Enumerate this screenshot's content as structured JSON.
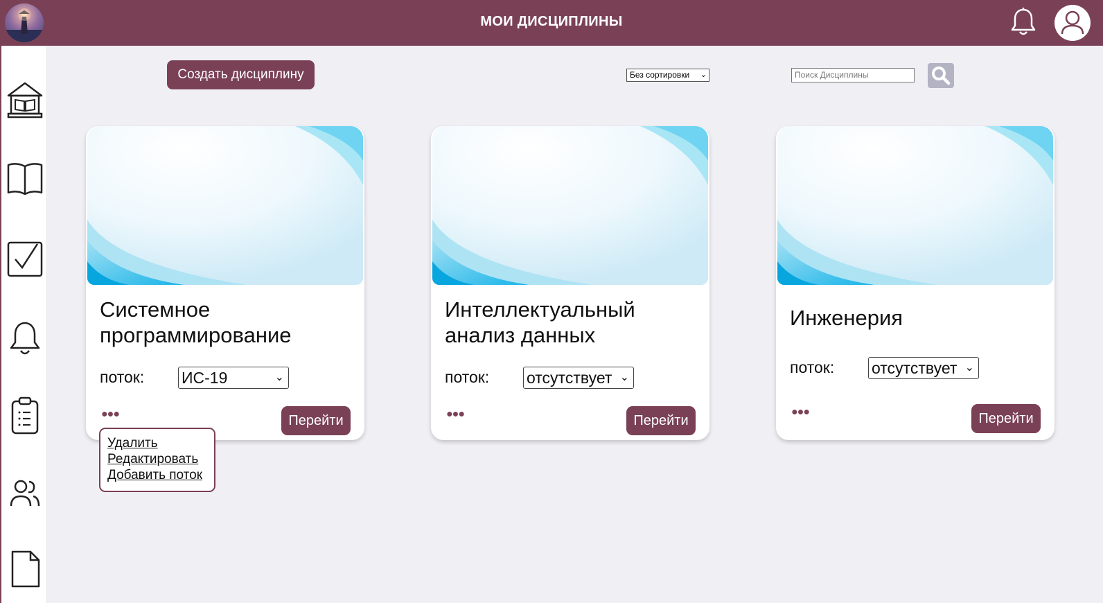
{
  "header": {
    "title": "МОИ ДИСЦИПЛИНЫ"
  },
  "colors": {
    "accent": "#7a4156",
    "background": "#f0eff4",
    "card": "#ffffff"
  },
  "sidebar": {
    "items": [
      {
        "icon": "home-library-icon"
      },
      {
        "icon": "open-book-icon"
      },
      {
        "icon": "checkbox-icon"
      },
      {
        "icon": "bell-icon"
      },
      {
        "icon": "clipboard-list-icon"
      },
      {
        "icon": "users-icon"
      },
      {
        "icon": "document-icon"
      }
    ]
  },
  "toolbar": {
    "create_label": "Создать дисциплину",
    "sort_value": "Без сортировки",
    "search_placeholder": "Поиск Дисциплины"
  },
  "cards": [
    {
      "title": "Системное программирование",
      "stream_label": "поток:",
      "stream_value": "ИС-19",
      "go_label": "Перейти"
    },
    {
      "title": "Интеллектуальный анализ данных",
      "stream_label": "поток:",
      "stream_value": "отсутствует",
      "go_label": "Перейти"
    },
    {
      "title": "Инженерия",
      "stream_label": "поток:",
      "stream_value": "отсутствует",
      "go_label": "Перейти"
    }
  ],
  "context_menu": {
    "items": [
      "Удалить",
      "Редактировать",
      "Добавить поток"
    ]
  }
}
